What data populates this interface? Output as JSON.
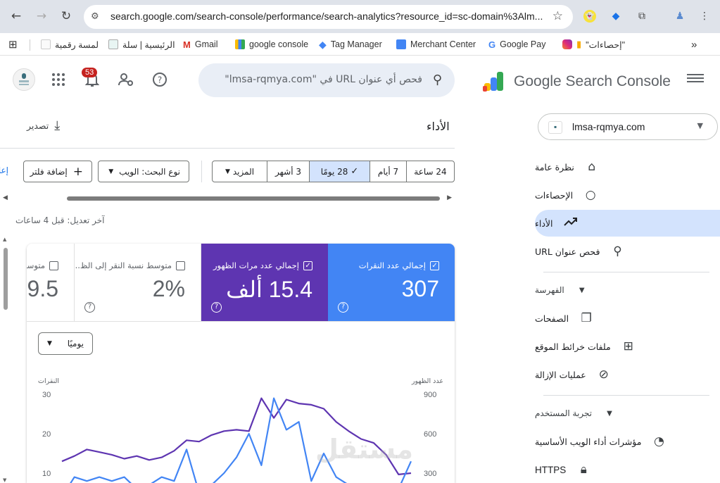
{
  "browser": {
    "url": "search.google.com/search-console/performance/search-analytics?resource_id=sc-domain%3Alm...",
    "bookmarks": [
      {
        "label": "لمسة رقمية",
        "icon": "lamsa-icon"
      },
      {
        "label": "الرئيسية | سلة",
        "icon": "salla-icon"
      },
      {
        "label": "Gmail",
        "icon": "gmail-icon"
      },
      {
        "label": "google console",
        "icon": "search-console-icon"
      },
      {
        "label": "Tag Manager",
        "icon": "tag-manager-icon"
      },
      {
        "label": "Merchant Center",
        "icon": "merchant-center-icon"
      },
      {
        "label": "Google Pay",
        "icon": "google-icon"
      },
      {
        "label": "\"إحصاءات\"",
        "icon": "analytics-icon"
      }
    ],
    "overflow_label": "»"
  },
  "header": {
    "brand": "Google Search Console",
    "search_placeholder": "فحص أي عنوان URL في \"lmsa-rqmya.com\"",
    "notifications_count": "53"
  },
  "sidebar": {
    "property": "lmsa-rqmya.com",
    "items": [
      {
        "label": "نظرة عامة",
        "icon": "home-icon"
      },
      {
        "label": "الإحصاءات",
        "icon": "lightbulb-icon"
      },
      {
        "label": "الأداء",
        "icon": "trending-up-icon"
      },
      {
        "label": "فحص عنوان URL",
        "icon": "search-icon"
      }
    ],
    "section_indexing": "الفهرسة",
    "indexing_items": [
      {
        "label": "الصفحات",
        "icon": "pages-icon"
      },
      {
        "label": "ملفات خرائط الموقع",
        "icon": "sitemap-icon"
      },
      {
        "label": "عمليات الإزالة",
        "icon": "visibility-off-icon"
      }
    ],
    "section_experience": "تجربة المستخدم",
    "experience_items": [
      {
        "label": "مؤشرات أداء الويب الأساسية",
        "icon": "speed-icon"
      },
      {
        "label": "HTTPS",
        "icon": "lock-icon"
      }
    ]
  },
  "main": {
    "title": "الأداء",
    "export_label": "تصدير",
    "ranges": [
      {
        "label": "24 ساعة",
        "selected": false
      },
      {
        "label": "7 أيام",
        "selected": false
      },
      {
        "label": "28 يومًا",
        "selected": true
      },
      {
        "label": "3 أشهر",
        "selected": false
      },
      {
        "label": "المزيد",
        "selected": false
      }
    ],
    "search_type_label": "نوع البحث: الويب",
    "add_filter_label": "إضافة فلتر",
    "reset_label": "إعا",
    "last_updated": "آخر تعديل: قبل 4 ساعات",
    "metrics": {
      "clicks": {
        "label": "إجمالي عدد النقرات",
        "value": "307"
      },
      "impressions": {
        "label": "إجمالي عدد مرات الظهور",
        "value": "15.4 ألف"
      },
      "ctr": {
        "label": "متوسط نسبة النقر إلى الظ...",
        "value": "2%"
      },
      "position": {
        "label": "متوسط",
        "value": "9.5"
      }
    },
    "granularity_label": "يوميًا",
    "watermark": "مستقل"
  },
  "chart_data": {
    "type": "line",
    "left_axis_label": "النقرات",
    "right_axis_label": "عدد الظهور",
    "left_ticks": [
      "30",
      "20",
      "10"
    ],
    "right_ticks": [
      "900",
      "600",
      "300"
    ],
    "ylim_left": [
      0,
      33
    ],
    "ylim_right": [
      0,
      990
    ],
    "colors": {
      "clicks": "#4285f4",
      "impressions": "#5e35b1"
    },
    "series": [
      {
        "key": "impressions",
        "axis": "right",
        "values": [
          390,
          430,
          480,
          460,
          440,
          410,
          430,
          400,
          420,
          470,
          550,
          540,
          590,
          620,
          630,
          620,
          870,
          720,
          860,
          830,
          820,
          790,
          690,
          620,
          560,
          530,
          440,
          290,
          300
        ]
      },
      {
        "key": "clicks",
        "axis": "left",
        "values": [
          4,
          9,
          8,
          9,
          8,
          9,
          6,
          7,
          9,
          8,
          16,
          5,
          7,
          10,
          14,
          20,
          12,
          29,
          21,
          23,
          8,
          15,
          9,
          7,
          5,
          7,
          5,
          6,
          13
        ]
      }
    ]
  }
}
